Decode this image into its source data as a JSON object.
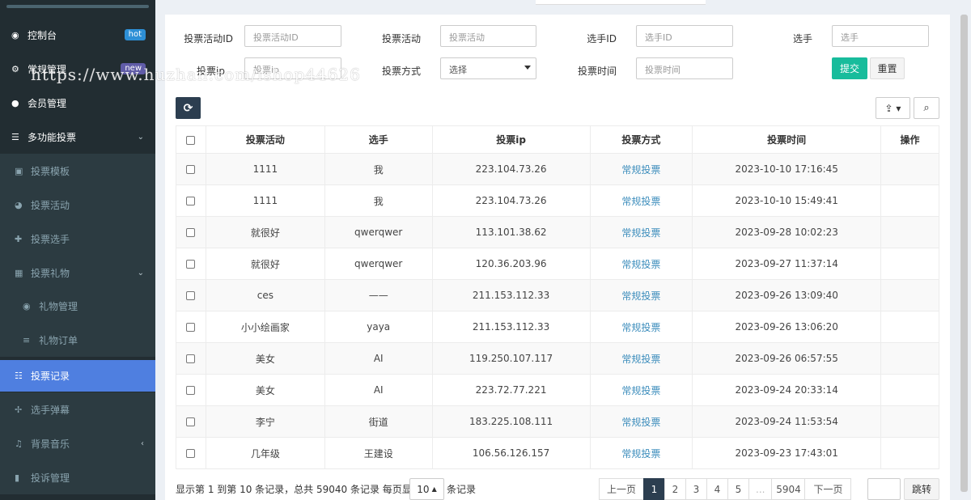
{
  "sidebar": {
    "items": [
      {
        "label": "控制台",
        "icon": "dashboard-icon",
        "badge": "hot"
      },
      {
        "label": "常规管理",
        "icon": "cogs-icon",
        "badge": "new"
      },
      {
        "label": "会员管理",
        "icon": "user-icon"
      },
      {
        "label": "多功能投票",
        "icon": "list-icon"
      },
      {
        "label": "投票模板",
        "icon": "image-icon"
      },
      {
        "label": "投票活动",
        "icon": "pie-icon"
      },
      {
        "label": "投票选手",
        "icon": "user-plus-icon"
      },
      {
        "label": "投票礼物",
        "icon": "gift-icon"
      },
      {
        "label": "礼物管理",
        "icon": "circle-play-icon"
      },
      {
        "label": "礼物订单",
        "icon": "bars-icon"
      },
      {
        "label": "投票记录",
        "icon": "list-ol-icon"
      },
      {
        "label": "选手弹幕",
        "icon": "arrows-icon"
      },
      {
        "label": "背景音乐",
        "icon": "music-icon"
      },
      {
        "label": "投诉管理",
        "icon": "bookmark-icon"
      }
    ]
  },
  "watermark": "https://www.huzhan.com/ishop44626",
  "filters": {
    "activity_id_label": "投票活动ID",
    "activity_id_placeholder": "投票活动ID",
    "activity_label": "投票活动",
    "activity_placeholder": "投票活动",
    "player_id_label": "选手ID",
    "player_id_placeholder": "选手ID",
    "player_label": "选手",
    "player_placeholder": "选手",
    "ip_label": "投票ip",
    "ip_placeholder": "投票ip",
    "method_label": "投票方式",
    "method_value": "选择",
    "time_label": "投票时间",
    "time_placeholder": "投票时间",
    "submit": "提交",
    "reset": "重置"
  },
  "table": {
    "headers": [
      "投票活动",
      "选手",
      "投票ip",
      "投票方式",
      "投票时间",
      "操作"
    ],
    "rows": [
      [
        "1111",
        "我",
        "223.104.73.26",
        "常规投票",
        "2023-10-10 17:16:45"
      ],
      [
        "1111",
        "我",
        "223.104.73.26",
        "常规投票",
        "2023-10-10 15:49:41"
      ],
      [
        "就很好",
        "qwerqwer",
        "113.101.38.62",
        "常规投票",
        "2023-09-28 10:02:23"
      ],
      [
        "就很好",
        "qwerqwer",
        "120.36.203.96",
        "常规投票",
        "2023-09-27 11:37:14"
      ],
      [
        "ces",
        "——",
        "211.153.112.33",
        "常规投票",
        "2023-09-26 13:09:40"
      ],
      [
        "小小绘画家",
        "yaya",
        "211.153.112.33",
        "常规投票",
        "2023-09-26 13:06:20"
      ],
      [
        "美女",
        "AI",
        "119.250.107.117",
        "常规投票",
        "2023-09-26 06:57:55"
      ],
      [
        "美女",
        "AI",
        "223.72.77.221",
        "常规投票",
        "2023-09-24 20:33:14"
      ],
      [
        "李宁",
        "街道",
        "183.225.108.111",
        "常规投票",
        "2023-09-24 11:53:54"
      ],
      [
        "几年级",
        "王建设",
        "106.56.126.157",
        "常规投票",
        "2023-09-23 17:43:01"
      ]
    ]
  },
  "footer": {
    "summary": "显示第 1 到第 10 条记录，总共 59040 条记录 每页显示",
    "page_size": "10",
    "records_suffix": "条记录",
    "prev": "上一页",
    "pages": [
      "1",
      "2",
      "3",
      "4",
      "5",
      "...",
      "5904"
    ],
    "next": "下一页",
    "jump": "跳转"
  }
}
